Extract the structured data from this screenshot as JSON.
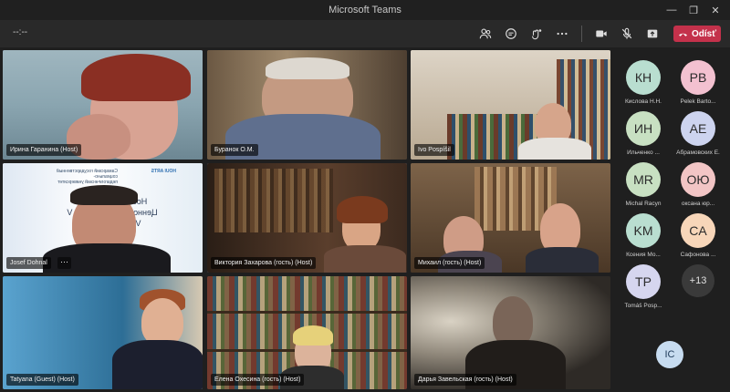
{
  "window": {
    "title": "Microsoft Teams",
    "controls": [
      "—",
      "❐",
      "✕"
    ]
  },
  "toolbar": {
    "timer": "--:--",
    "leave_label": "Odísť"
  },
  "tiles": [
    {
      "name": "Ирина Гаранина (Host)"
    },
    {
      "name": "Буранок О.М."
    },
    {
      "name": "Ivo Pospíšil"
    },
    {
      "name": "Josef Dohnal",
      "more": "···"
    },
    {
      "name": "Виктория Захарова (гость) (Host)"
    },
    {
      "name": "Михаил (гость) (Host)"
    },
    {
      "name": "Tatyana (Guest) (Host)"
    },
    {
      "name": "Елена Охесина (гость) (Host)"
    },
    {
      "name": "Дарья Завельская (гость) (Host)"
    }
  ],
  "slide": {
    "line1": "Самарский государственный социально-",
    "line2": "педагогический университет",
    "logo_text": "HOUI ARTS",
    "lines": [
      "Hodnoty v umění V",
      "Ценности в искусстве V",
      "Values in Arts V"
    ]
  },
  "roster": [
    {
      "initials": "КН",
      "name": "Кислова Н.Н.",
      "color": "#b9ded0"
    },
    {
      "initials": "PB",
      "name": "Pelek Barto...",
      "color": "#f3c1d0"
    },
    {
      "initials": "ИН",
      "name": "Ильченко ...",
      "color": "#c8e0c2"
    },
    {
      "initials": "AE",
      "name": "Абрамовских Е.",
      "color": "#cdd4ef"
    },
    {
      "initials": "MR",
      "name": "Michal Racyn",
      "color": "#c8e0c2"
    },
    {
      "initials": "ОЮ",
      "name": "оксана юр...",
      "color": "#f2c5c5"
    },
    {
      "initials": "KM",
      "name": "Ксения Мо...",
      "color": "#b9ded0"
    },
    {
      "initials": "CA",
      "name": "Сафонова ...",
      "color": "#f7d6b9"
    },
    {
      "initials": "TP",
      "name": "Tomáš Posp...",
      "color": "#d6d6ef"
    },
    {
      "initials": "+13",
      "name": "",
      "color": "#3a3a3a"
    }
  ],
  "self": {
    "initials": "IC"
  }
}
